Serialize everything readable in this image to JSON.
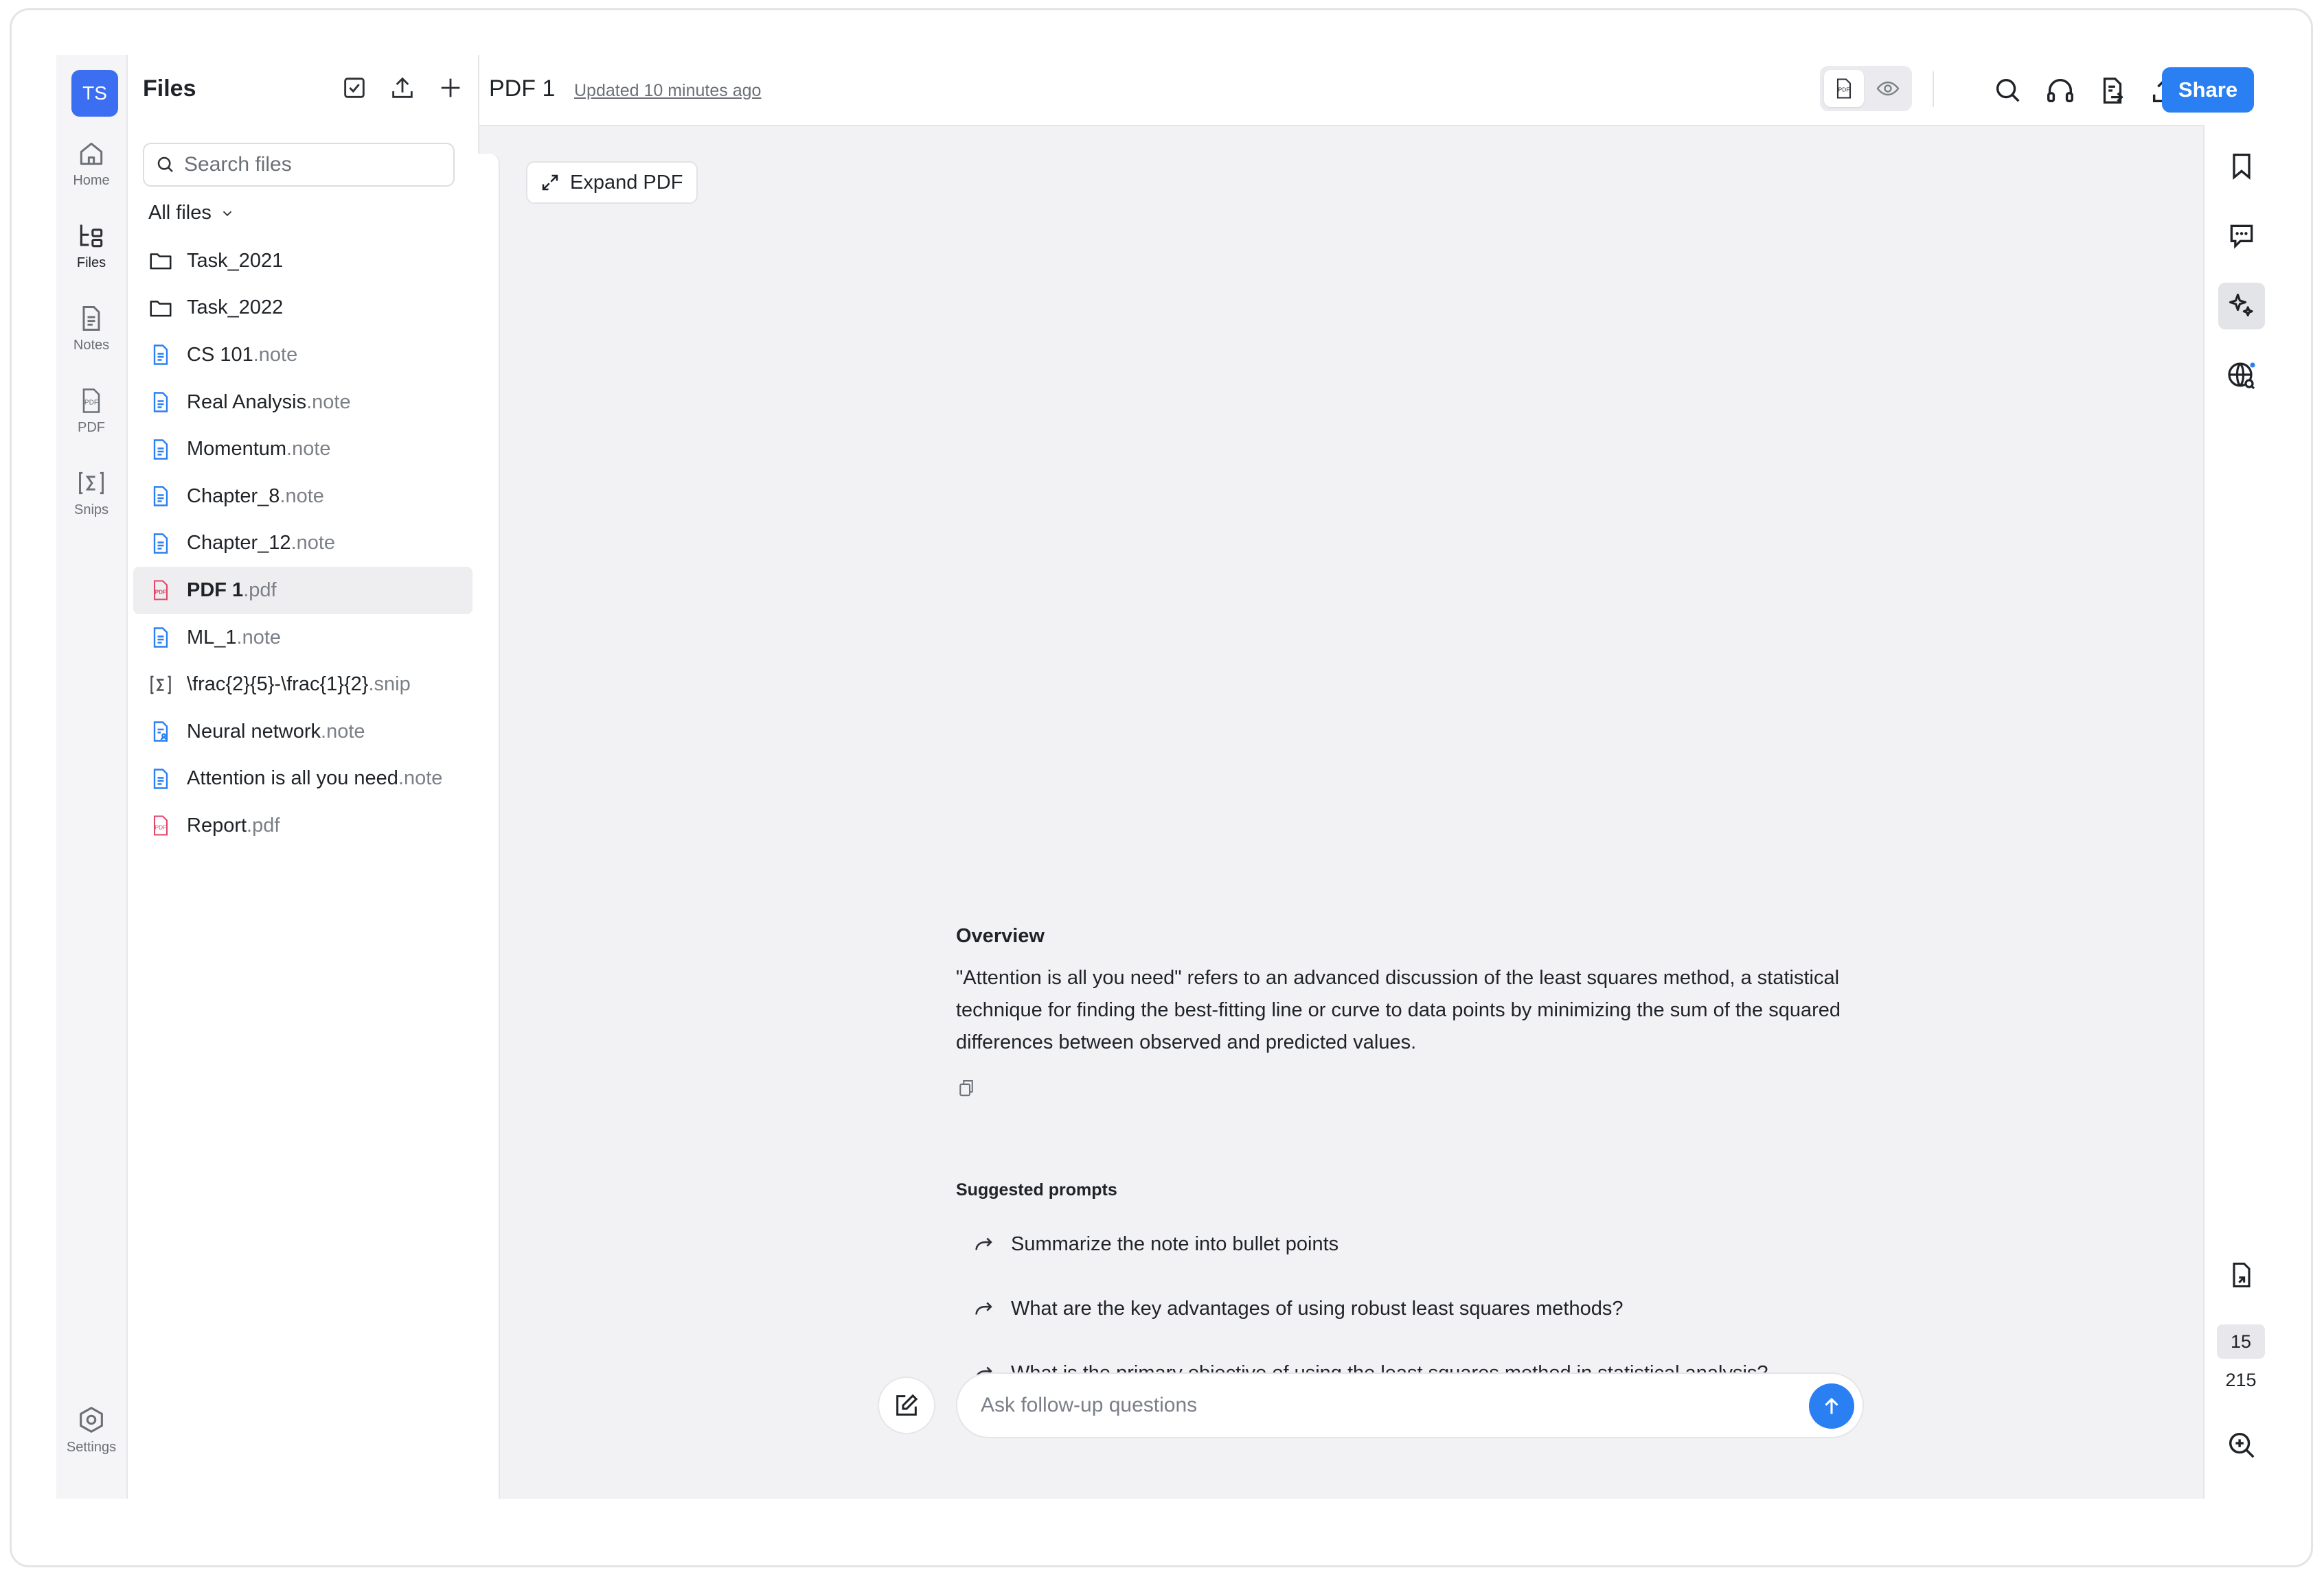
{
  "rail": {
    "avatar": "TS",
    "items": [
      {
        "label": "Home",
        "icon": "home-icon"
      },
      {
        "label": "Files",
        "icon": "files-icon"
      },
      {
        "label": "Notes",
        "icon": "notes-icon"
      },
      {
        "label": "PDF",
        "icon": "pdf-icon"
      },
      {
        "label": "Snips",
        "icon": "sigma-icon"
      }
    ],
    "settings_label": "Settings"
  },
  "files": {
    "title": "Files",
    "search_placeholder": "Search files",
    "filter_label": "All files",
    "items": [
      {
        "name": "Task_2021",
        "ext": "",
        "type": "folder"
      },
      {
        "name": "Task_2022",
        "ext": "",
        "type": "folder"
      },
      {
        "name": "CS 101",
        "ext": ".note",
        "type": "note"
      },
      {
        "name": "Real Analysis",
        "ext": ".note",
        "type": "note"
      },
      {
        "name": "Momentum",
        "ext": ".note",
        "type": "note"
      },
      {
        "name": "Chapter_8",
        "ext": ".note",
        "type": "note"
      },
      {
        "name": "Chapter_12",
        "ext": ".note",
        "type": "note"
      },
      {
        "name": "PDF 1",
        "ext": ".pdf",
        "type": "pdf",
        "selected": true
      },
      {
        "name": "ML_1",
        "ext": ".note",
        "type": "note"
      },
      {
        "name": "\\frac{2}{5}-\\frac{1}{2}",
        "ext": ".snip",
        "type": "snip"
      },
      {
        "name": "Neural network",
        "ext": ".note",
        "type": "shared-note"
      },
      {
        "name": "Attention is all you need",
        "ext": ".note",
        "type": "note"
      },
      {
        "name": "Report",
        "ext": ".pdf",
        "type": "pdf"
      }
    ]
  },
  "topbar": {
    "title": "PDF 1",
    "updated": "Updated 10 minutes ago",
    "share_label": "Share"
  },
  "viewer": {
    "expand_label": "Expand PDF",
    "page_current": "15",
    "page_total": "215"
  },
  "assistant": {
    "overview_title": "Overview",
    "overview_text": "\"Attention is all you need\" refers to an advanced discussion of the least squares method, a statistical technique for finding the best-fitting line or curve to data points by minimizing the sum of the squared differences between observed and predicted values.",
    "suggested_title": "Suggested prompts",
    "prompts": [
      "Summarize the note into bullet points",
      "What are the key advantages of using robust least squares methods?",
      "What is the primary objective of using the least squares method in statistical analysis?"
    ],
    "input_placeholder": "Ask follow-up questions"
  },
  "colors": {
    "accent": "#2a7ff3",
    "avatar": "#3b6ef0",
    "note_icon": "#2a7ff3",
    "pdf_icon": "#e0456a"
  }
}
